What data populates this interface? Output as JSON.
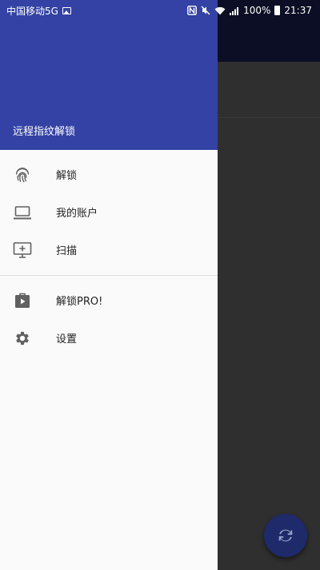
{
  "status_bar": {
    "carrier": "中国移动5G",
    "battery": "100%",
    "time": "21:37"
  },
  "drawer": {
    "title": "远程指纹解锁",
    "items": [
      {
        "label": "解锁",
        "icon": "fingerprint-icon"
      },
      {
        "label": "我的账户",
        "icon": "laptop-icon"
      },
      {
        "label": "扫描",
        "icon": "add-to-screen-icon"
      }
    ],
    "items2": [
      {
        "label": "解锁PRO!",
        "icon": "store-icon"
      },
      {
        "label": "设置",
        "icon": "gear-icon"
      }
    ]
  },
  "colors": {
    "header": "#3342a4",
    "drawer_bg": "#fafafa",
    "icon_gray": "#616161",
    "fab": "#1f2a6b"
  }
}
